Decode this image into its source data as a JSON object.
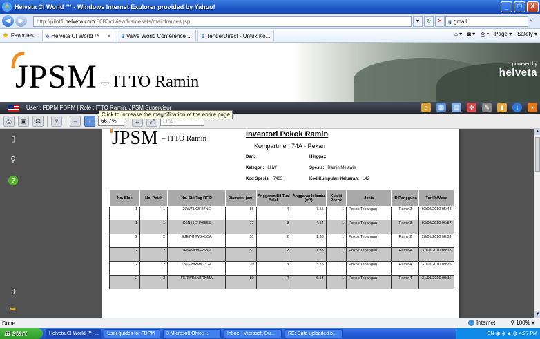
{
  "window": {
    "title": "Helveta CI World ™ - Windows Internet Explorer provided by Yahoo!",
    "controls": [
      "_",
      "□",
      "X"
    ]
  },
  "address_bar": {
    "url_prefix": "http://pilot1.",
    "url_host": "helveta.com",
    "url_path": ":8080/ciview/framesets/mainframes.jsp",
    "search_value": "gmail"
  },
  "favorites_bar": {
    "favorites_label": "Favorites",
    "tabs": [
      {
        "label": "Helveta CI World ™"
      },
      {
        "label": "Valve World Conference ..."
      },
      {
        "label": "TenderDirect - Untuk Ko..."
      }
    ],
    "right_items": [
      "Page ▾",
      "Safety ▾"
    ]
  },
  "banner": {
    "logo": "JPSM",
    "logo_sub": "– ITTO Ramin",
    "powered_by": "powered by",
    "brand": "helveta"
  },
  "user_bar": {
    "text": "User : FDPM FDPM  |  Role : ITTO Ramin, JPSM Supervisor"
  },
  "viewer_toolbar": {
    "zoom": "66.7%",
    "find_placeholder": "Find",
    "tooltip": "Click to increase the magnification of the entire page"
  },
  "report": {
    "logo": "JPSM",
    "logo_sub": "– ITTO Ramin",
    "title": "Inventori Pokok Ramin",
    "subtitle": "Kompartmen 74A - Pekan",
    "meta": {
      "dari_label": "Dari:",
      "hingga_label": "Hingga::",
      "kategori_label": "Kategori:",
      "kategori_value": "LHW",
      "spesis_label": "Spesis:",
      "spesis_value": "Ramin Melawis",
      "kod_spesis_label": "Kod Spesis:",
      "kod_spesis_value": "7403",
      "kod_kumpulan_label": "Kod Kumpulan Keluaran:",
      "kod_kumpulan_value": "L42"
    },
    "columns": [
      "No. Blok",
      "No. Petak",
      "No. Siri Tag RFID",
      "Diameter (cm)",
      "Anggaran Bil Tual Balak",
      "Anggaran Isipadu (m3)",
      "Kualiti Pokok",
      "Jenis",
      "ID Pengguna",
      "Tarikh/Masa"
    ],
    "rows": [
      [
        "1",
        "1",
        "29W71KJF27NE",
        "86",
        "4",
        "7.55",
        "1",
        "Pokok Tebangan",
        "Ramin2",
        "03/02/2010 05:48"
      ],
      [
        "1",
        "1",
        "C6N51EHX6555",
        "77",
        "3",
        "4.54",
        "1",
        "Pokok Tebangan",
        "Ramin3",
        "03/02/2010 06:57"
      ],
      [
        "2",
        "2",
        "EJE7KNW3H3CA",
        "51",
        "2",
        "1.33",
        "1",
        "Pokok Tebangan",
        "Ramin2",
        "28/01/2010 08:59"
      ],
      [
        "2",
        "2",
        "JEN4W38E265M",
        "51",
        "2",
        "1.33",
        "1",
        "Pokok Tebangan",
        "Ramin4",
        "31/01/2010 09:18"
      ],
      [
        "2",
        "2",
        "L51FWRMN7Y24",
        "70",
        "3",
        "3.75",
        "1",
        "Pokok Tebangan",
        "Ramin4",
        "31/01/2010 09:25"
      ],
      [
        "2",
        "3",
        "FKRWR6N4RNMA",
        "80",
        "4",
        "6.53",
        "1",
        "Pokok Tebangan",
        "Ramin4",
        "31/01/2010 09:11"
      ]
    ]
  },
  "status_bar": {
    "left": "Done",
    "zone": "Internet",
    "zoom": "100%"
  },
  "taskbar": {
    "start": "start",
    "tasks": [
      {
        "label": "Helveta CI World ™ -..."
      },
      {
        "label": "User guides for FDPM"
      },
      {
        "label": "3 Microsoft Office ..."
      },
      {
        "label": "Inbox - Microsoft Ou..."
      },
      {
        "label": "RE: Data uploaded b..."
      }
    ],
    "lang": "EN",
    "clock": "4:27 PM"
  }
}
